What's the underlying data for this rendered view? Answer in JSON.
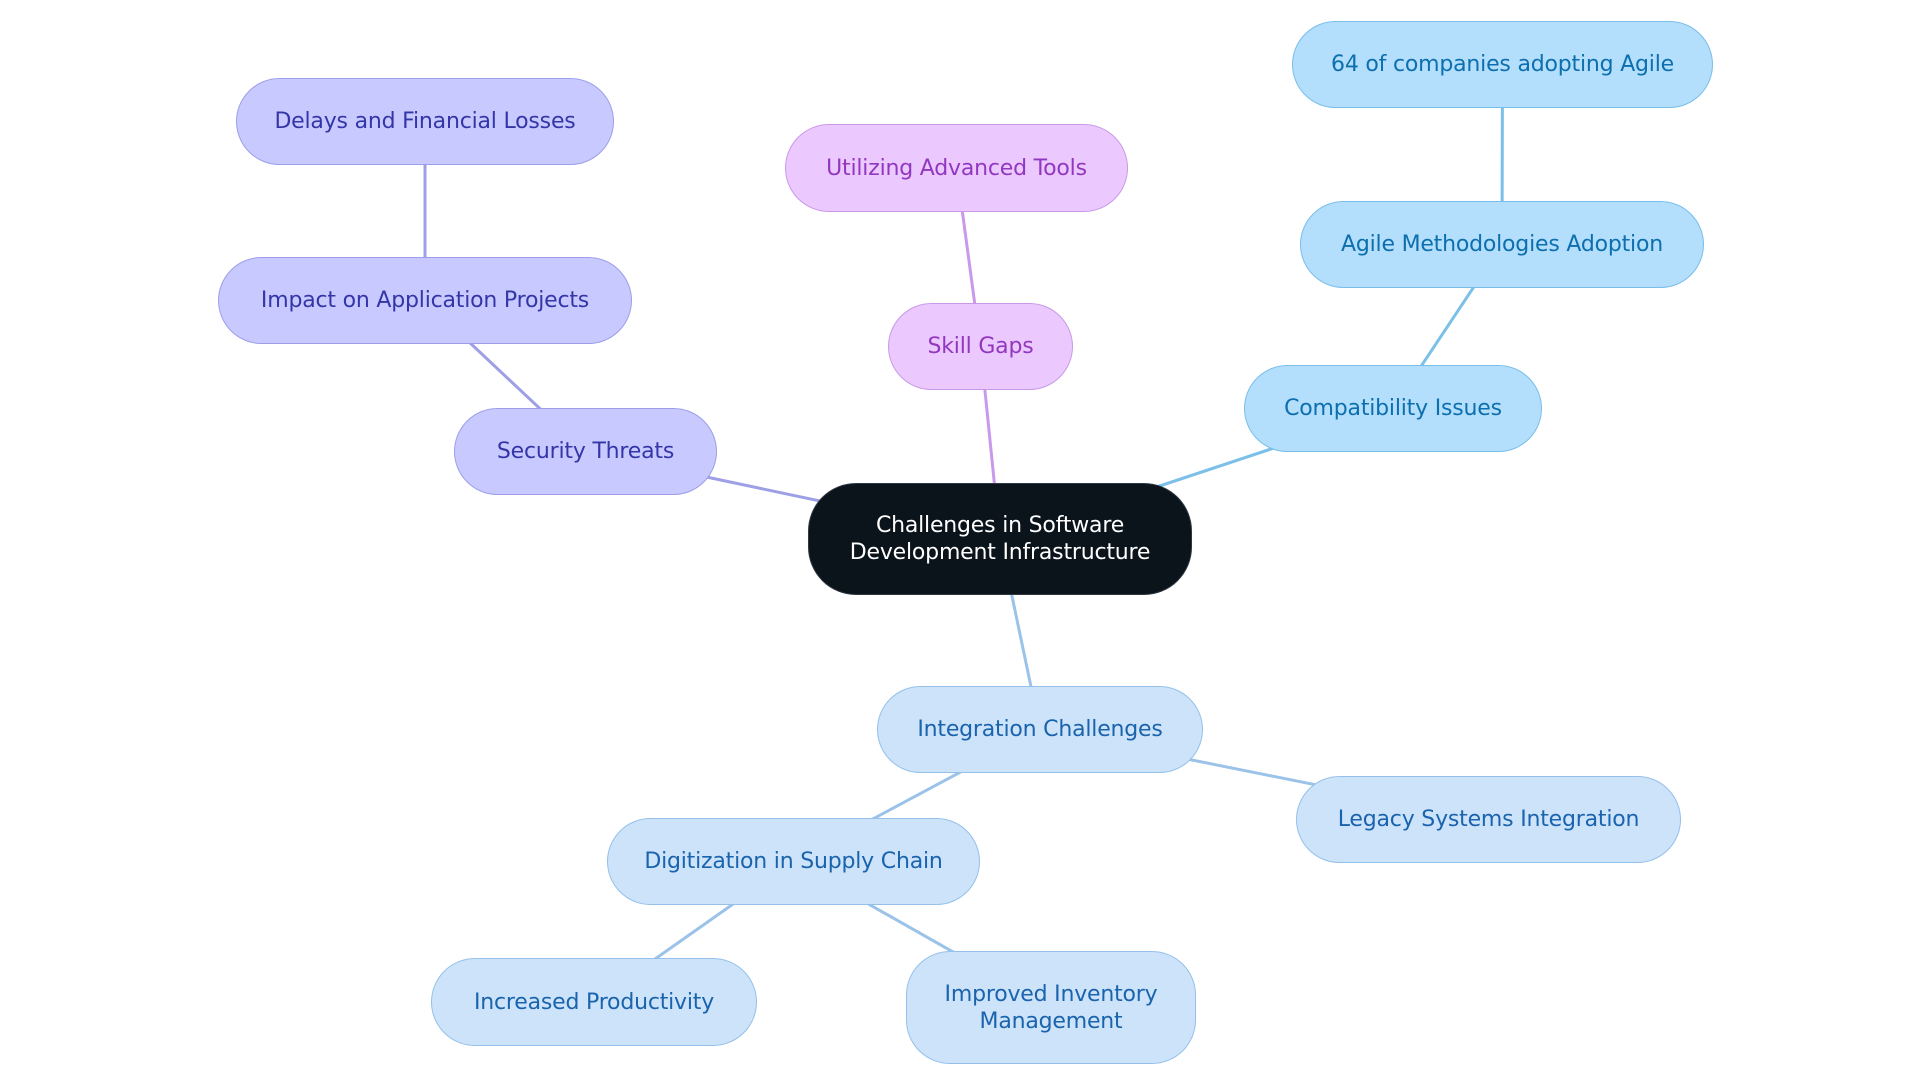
{
  "diagram": {
    "title": "Challenges in Software Development Infrastructure",
    "colors": {
      "root_fill": "#0b131b",
      "root_text": "#ffffff",
      "indigo_fill": "#c8caff",
      "indigo_text": "#3436a8",
      "indigo_edge": "#9ea0e6",
      "purple_fill": "#ebc8fe",
      "purple_text": "#9238c0",
      "purple_edge": "#c999ec",
      "sky_fill": "#b3dffc",
      "sky_text": "#0d6fae",
      "sky_edge": "#7cbfe8",
      "blue_fill": "#cde3fa",
      "blue_text": "#1a63ad",
      "blue_edge": "#9bc3ea"
    },
    "nodes": {
      "root": {
        "label": "Challenges in Software Development Infrastructure",
        "lines": [
          "Challenges in Software",
          "Development Infrastructure"
        ]
      },
      "security_threats": {
        "label": "Security Threats"
      },
      "impact_on_application_projects": {
        "label": "Impact on Application Projects"
      },
      "delays_and_financial_losses": {
        "label": "Delays and Financial Losses"
      },
      "skill_gaps": {
        "label": "Skill Gaps"
      },
      "utilizing_advanced_tools": {
        "label": "Utilizing Advanced Tools"
      },
      "compatibility_issues": {
        "label": "Compatibility Issues"
      },
      "agile_methodologies_adoption": {
        "label": "Agile Methodologies Adoption"
      },
      "companies_adopting_agile": {
        "label": "64 of companies adopting Agile"
      },
      "integration_challenges": {
        "label": "Integration Challenges"
      },
      "legacy_systems_integration": {
        "label": "Legacy Systems Integration"
      },
      "digitization_in_supply_chain": {
        "label": "Digitization in Supply Chain"
      },
      "increased_productivity": {
        "label": "Increased Productivity"
      },
      "improved_inventory_management": {
        "label": "Improved Inventory Management",
        "lines": [
          "Improved Inventory",
          "Management"
        ]
      }
    },
    "edges": [
      {
        "from": "root",
        "to": "security_threats",
        "branch": "indigo"
      },
      {
        "from": "security_threats",
        "to": "impact_on_application_projects",
        "branch": "indigo"
      },
      {
        "from": "impact_on_application_projects",
        "to": "delays_and_financial_losses",
        "branch": "indigo"
      },
      {
        "from": "root",
        "to": "skill_gaps",
        "branch": "purple"
      },
      {
        "from": "skill_gaps",
        "to": "utilizing_advanced_tools",
        "branch": "purple"
      },
      {
        "from": "root",
        "to": "compatibility_issues",
        "branch": "sky"
      },
      {
        "from": "compatibility_issues",
        "to": "agile_methodologies_adoption",
        "branch": "sky"
      },
      {
        "from": "agile_methodologies_adoption",
        "to": "companies_adopting_agile",
        "branch": "sky"
      },
      {
        "from": "root",
        "to": "integration_challenges",
        "branch": "blue"
      },
      {
        "from": "integration_challenges",
        "to": "legacy_systems_integration",
        "branch": "blue"
      },
      {
        "from": "integration_challenges",
        "to": "digitization_in_supply_chain",
        "branch": "blue"
      },
      {
        "from": "digitization_in_supply_chain",
        "to": "increased_productivity",
        "branch": "blue"
      },
      {
        "from": "digitization_in_supply_chain",
        "to": "improved_inventory_management",
        "branch": "blue"
      }
    ]
  }
}
